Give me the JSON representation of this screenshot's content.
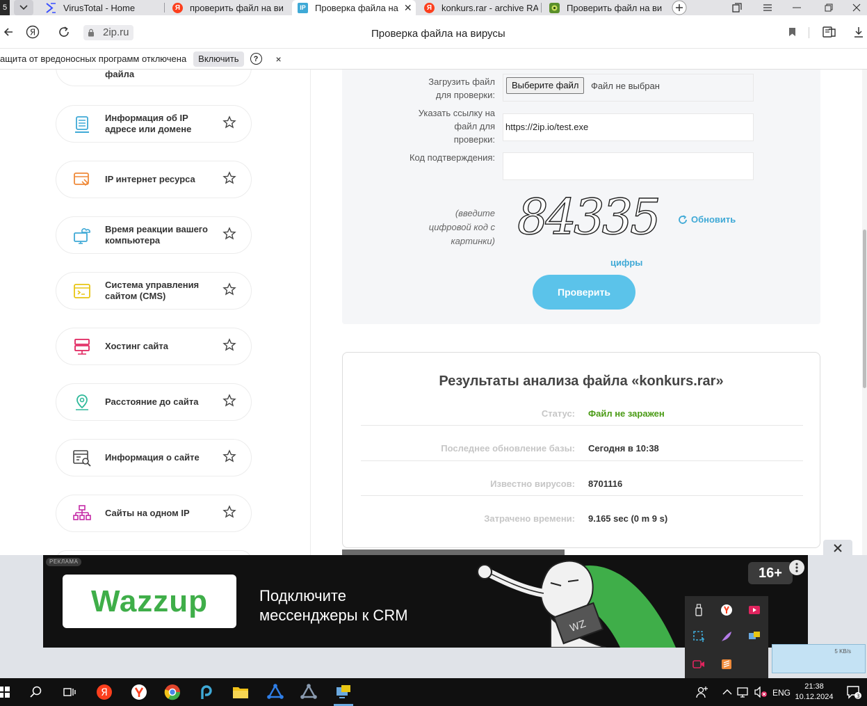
{
  "browser": {
    "tabs": [
      {
        "label": "VirusTotal - Home",
        "icon": "virustotal-icon",
        "color": "#394eff"
      },
      {
        "label": "проверить файл на ви",
        "icon": "yandex-icon",
        "color": "#fc3f1d"
      },
      {
        "label": "Проверка файла на",
        "icon": "2ip-icon",
        "color": "#3fa9d6",
        "active": true
      },
      {
        "label": "konkurs.rar - archive RA",
        "icon": "yandex-icon",
        "color": "#fc3f1d"
      },
      {
        "label": "Проверить файл на ви",
        "icon": "antivirus-icon",
        "color": "#5a8f2a"
      }
    ],
    "url": "2ip.ru",
    "page_title": "Проверка файла на вирусы",
    "notice": {
      "text": "ащита от вредоносных программ отключена",
      "enable_label": "Включить",
      "help": "?",
      "close": "×"
    }
  },
  "sidebar": {
    "items": [
      {
        "label": "файла",
        "icon": "file-icon",
        "color": "#e0245e"
      },
      {
        "label": "Информация об IP адресе или домене",
        "icon": "server-info-icon",
        "color": "#3fa9d6"
      },
      {
        "label": "IP интернет ресурса",
        "icon": "web-resource-icon",
        "color": "#ef8a3a"
      },
      {
        "label": "Время реакции вашего компьютера",
        "icon": "computer-cloud-icon",
        "color": "#3fa9d6"
      },
      {
        "label": "Система управления сайтом (CMS)",
        "icon": "cms-icon",
        "color": "#e8c513"
      },
      {
        "label": "Хостинг сайта",
        "icon": "hosting-icon",
        "color": "#e0245e"
      },
      {
        "label": "Расстояние до сайта",
        "icon": "location-pin-icon",
        "color": "#2fb99a"
      },
      {
        "label": "Информация о сайте",
        "icon": "site-info-icon",
        "color": "#444444"
      },
      {
        "label": "Сайты на одном IP",
        "icon": "network-tree-icon",
        "color": "#c42aa6"
      }
    ]
  },
  "form": {
    "upload_label": "Загрузить файл для проверки:",
    "upload_button": "Выберите файл",
    "upload_status": "Файл не выбран",
    "link_label": "Указать ссылку на файл для проверки:",
    "link_value": "https://2ip.io/test.exe",
    "code_label": "Код подтверждения:",
    "code_value": "",
    "captcha_hint": "(введите цифровой код с картинки)",
    "captcha_text": "84335",
    "refresh_label": "Обновить",
    "digits_label": "цифры",
    "check_button": "Проверить"
  },
  "results": {
    "title": "Результаты анализа файла «konkurs.rar»",
    "rows": [
      {
        "key": "Статус:",
        "value": "Файл не заражен"
      },
      {
        "key": "Последнее обновление базы:",
        "value": "Сегодня в 10:38"
      },
      {
        "key": "Известно вирусов:",
        "value": "8701116"
      },
      {
        "key": "Затрачено времени:",
        "value": "9.165 sec (0 m 9 s)"
      }
    ],
    "status_color": "#4a9b15"
  },
  "ad": {
    "badge": "РЕКЛАМА",
    "brand": "Wazzup",
    "text_line1": "Подключите",
    "text_line2": "мессенджеры к CRM",
    "age": "16+",
    "close": "×",
    "brand_color": "#3fae49"
  },
  "tray": {
    "net_speed": "5 KB/s"
  },
  "taskbar": {
    "lang": "ENG",
    "time": "21:38",
    "date": "10.12.2024",
    "notifications": "3"
  },
  "colors": {
    "accent": "#5bc3ea",
    "link": "#3fa9d6"
  }
}
